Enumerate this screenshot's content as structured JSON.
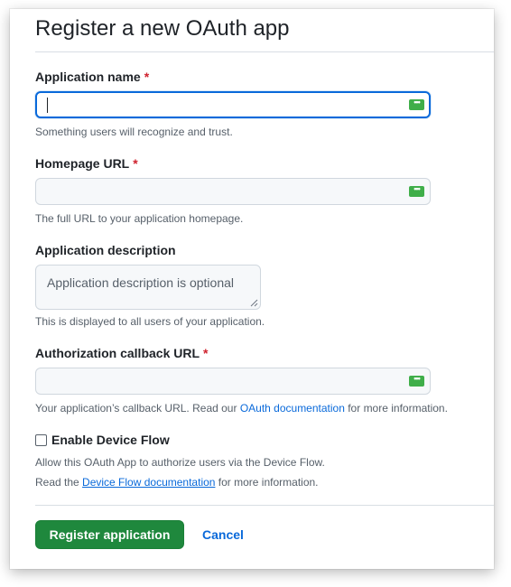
{
  "page": {
    "title": "Register a new OAuth app"
  },
  "fields": {
    "app_name": {
      "label": "Application name",
      "required_mark": "*",
      "value": "",
      "hint": "Something users will recognize and trust."
    },
    "homepage_url": {
      "label": "Homepage URL",
      "required_mark": "*",
      "value": "",
      "hint": "The full URL to your application homepage."
    },
    "description": {
      "label": "Application description",
      "placeholder": "Application description is optional",
      "hint": "This is displayed to all users of your application."
    },
    "callback_url": {
      "label": "Authorization callback URL",
      "required_mark": "*",
      "value": "",
      "hint_prefix": "Your application’s callback URL. Read our ",
      "hint_link": "OAuth documentation",
      "hint_suffix": " for more information."
    },
    "device_flow": {
      "label": "Enable Device Flow",
      "checked": false,
      "hint_line1": "Allow this OAuth App to authorize users via the Device Flow.",
      "hint_line2_prefix": "Read the ",
      "hint_line2_link": "Device Flow documentation",
      "hint_line2_suffix": " for more information."
    }
  },
  "actions": {
    "submit_label": "Register application",
    "cancel_label": "Cancel"
  },
  "icons": {
    "password_manager": "password-manager-icon",
    "resize": "resize-grip-icon"
  },
  "colors": {
    "primary_button": "#1f883d",
    "link": "#0969da",
    "required": "#cf222e",
    "focus_ring": "#0969da",
    "pw_icon": "#3fae49"
  }
}
